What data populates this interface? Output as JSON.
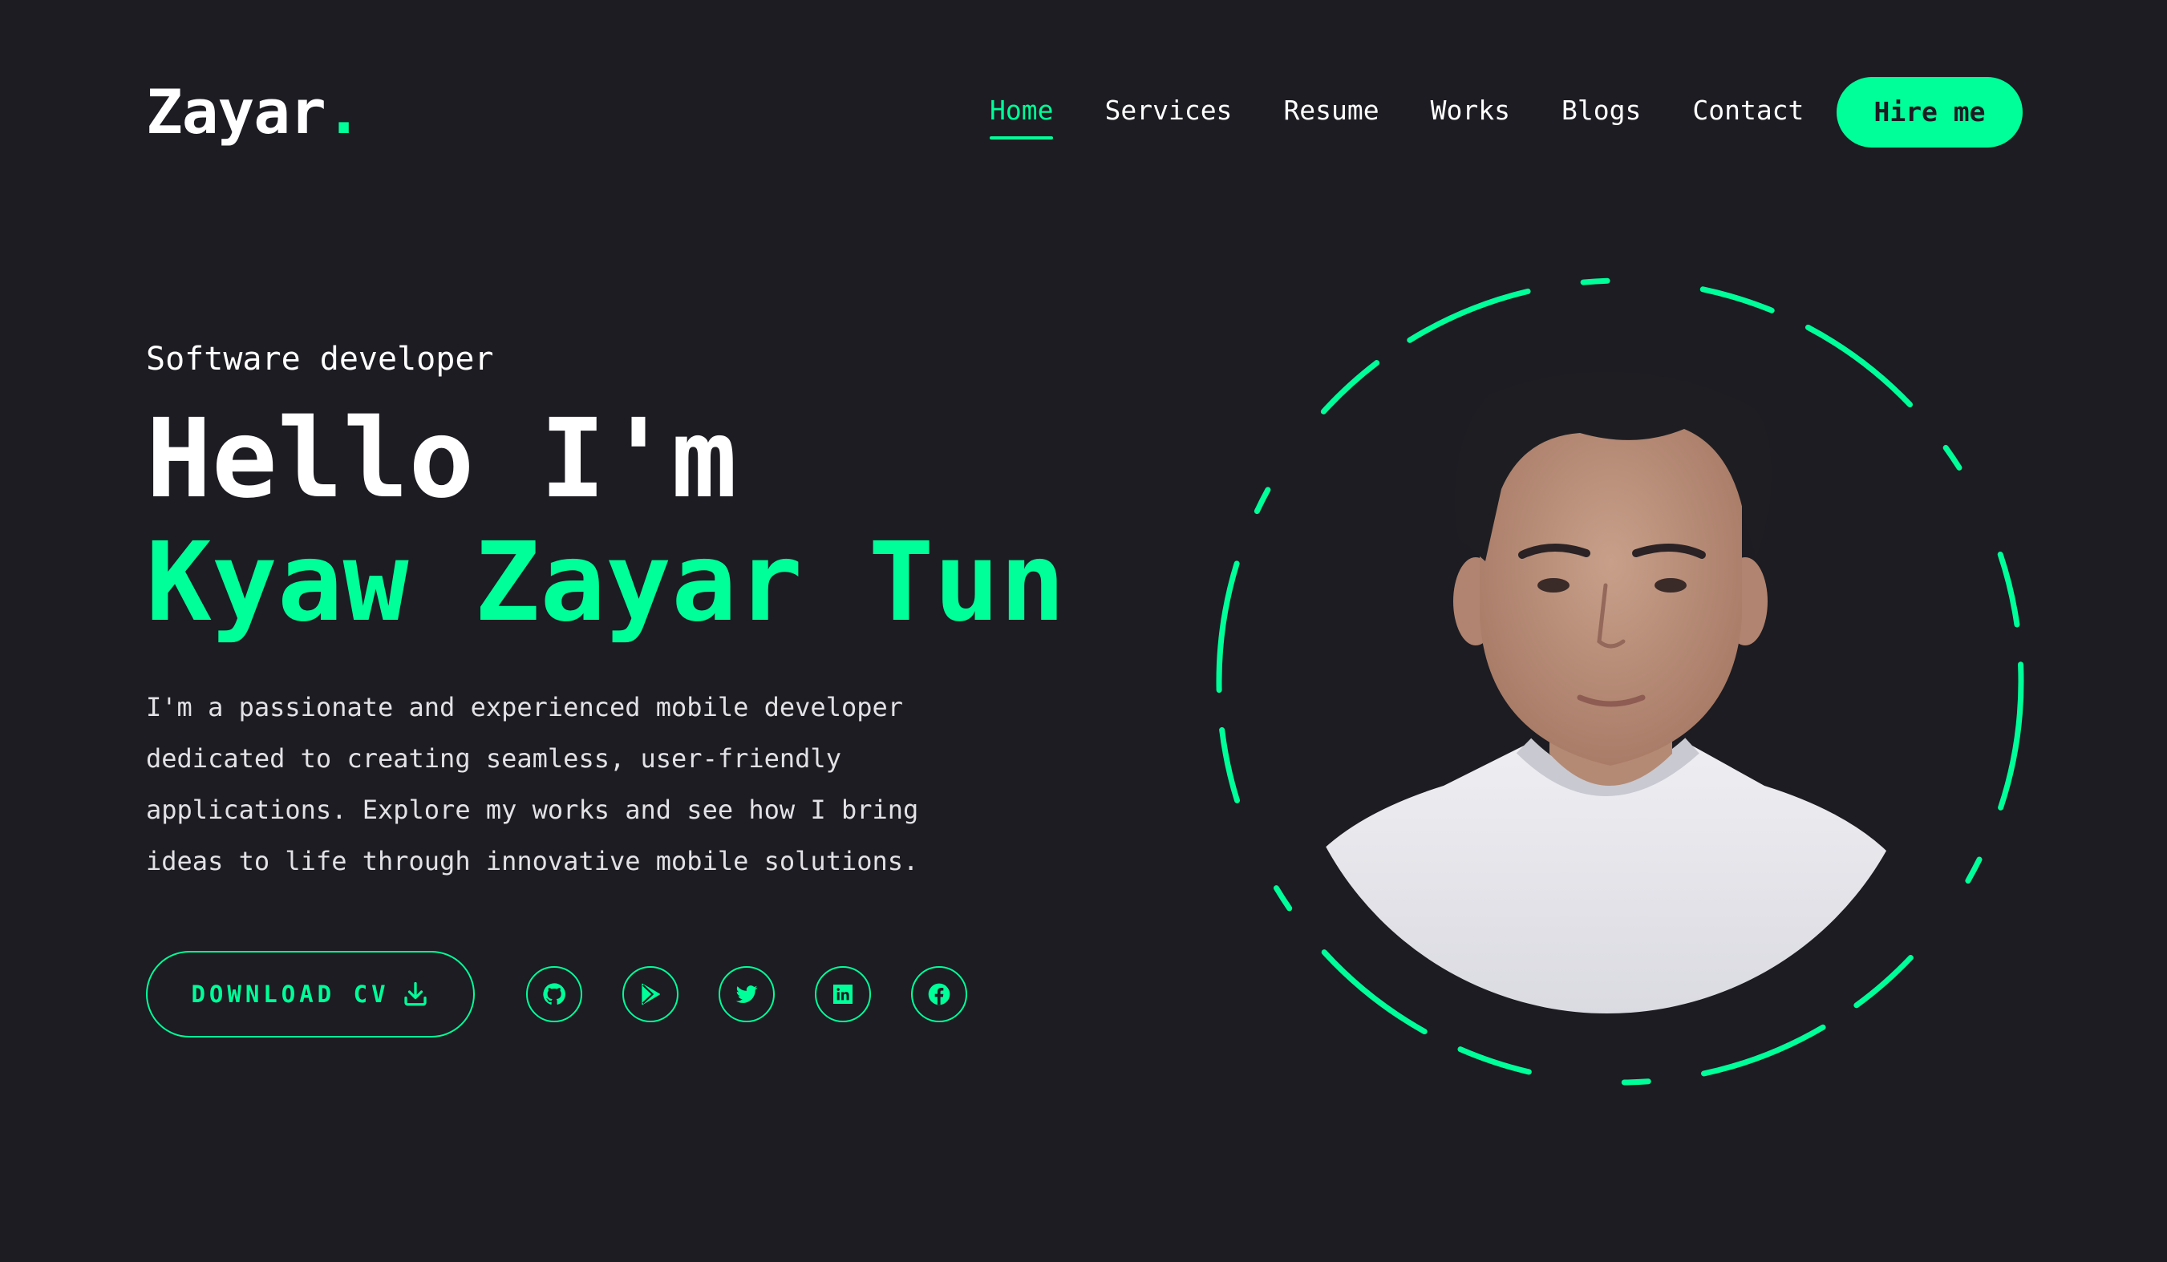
{
  "header": {
    "logo_text": "Zayar",
    "logo_dot": ".",
    "nav": [
      {
        "label": "Home",
        "active": true
      },
      {
        "label": "Services",
        "active": false
      },
      {
        "label": "Resume",
        "active": false
      },
      {
        "label": "Works",
        "active": false
      },
      {
        "label": "Blogs",
        "active": false
      },
      {
        "label": "Contact",
        "active": false
      }
    ],
    "hire_label": "Hire me"
  },
  "hero": {
    "role": "Software developer",
    "greeting": "Hello I'm",
    "name": "Kyaw Zayar Tun",
    "bio": "I'm a passionate and experienced mobile developer dedicated to creating seamless, user-friendly applications. Explore my works and see how I bring ideas to life through innovative mobile solutions.",
    "download_label": "DOWNLOAD CV",
    "download_icon": "download-icon",
    "socials": [
      {
        "icon": "github-icon"
      },
      {
        "icon": "play-store-icon"
      },
      {
        "icon": "twitter-icon"
      },
      {
        "icon": "linkedin-icon"
      },
      {
        "icon": "facebook-icon"
      }
    ]
  },
  "colors": {
    "background": "#1c1c22",
    "accent": "#00ff99",
    "text": "#ffffff"
  }
}
